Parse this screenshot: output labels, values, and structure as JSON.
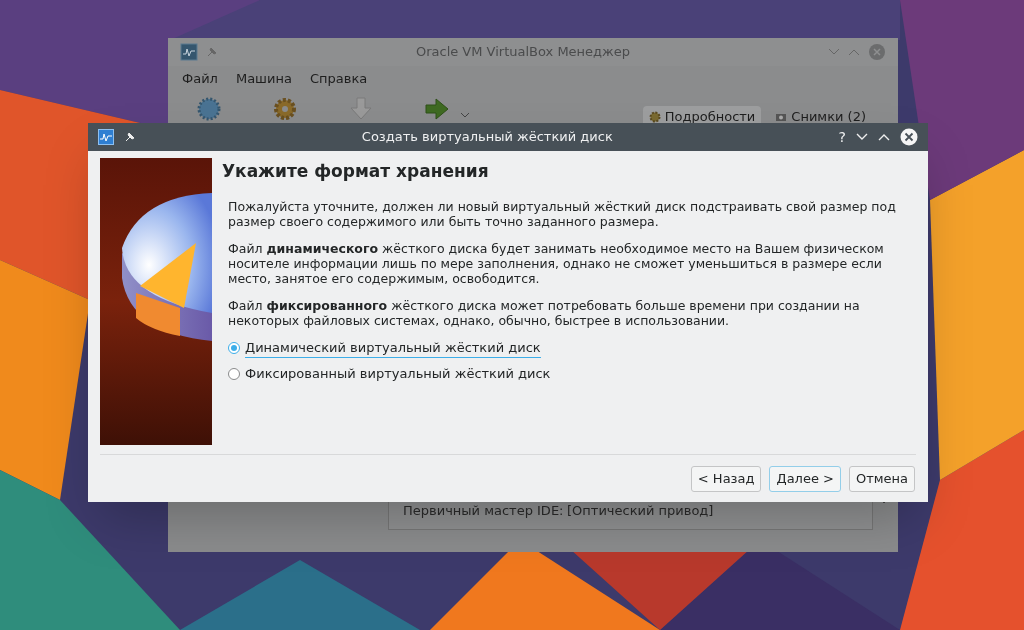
{
  "manager_window": {
    "title": "Oracle VM VirtualBox Менеджер",
    "menu": [
      "Файл",
      "Машина",
      "Справка"
    ],
    "tabs": [
      {
        "label": "Подробности",
        "selected": true
      },
      {
        "label": "Снимки (2)",
        "selected": false
      }
    ],
    "details": [
      {
        "label": "Первичный мастер IDE:",
        "value": "[Оптический привод]"
      }
    ]
  },
  "dialog": {
    "title": "Создать виртуальный жёсткий диск",
    "title_buttons": [
      "?"
    ],
    "heading": "Укажите формат хранения",
    "paragraphs": [
      "Пожалуйста уточните, должен ли новый виртуальный жёсткий диск подстраивать свой размер под размер своего содержимого или быть точно заданного размера.",
      "Файл **динамического** жёсткого диска будет занимать необходимое место на Вашем физическом носителе информации лишь по мере заполнения, однако не сможет уменьшиться в размере если место, занятое его содержимым, освободится.",
      "Файл **фиксированного** жёсткого диска может потребовать больше времени при создании на некоторых файловых системах, однако, обычно, быстрее в использовании."
    ],
    "options": [
      {
        "label": "Динамический виртуальный жёсткий диск",
        "selected": true
      },
      {
        "label": "Фиксированный виртуальный жёсткий диск",
        "selected": false
      }
    ],
    "buttons": [
      {
        "label": "< Назад",
        "kind": "normal"
      },
      {
        "label": "Далее >",
        "kind": "default"
      },
      {
        "label": "Отмена",
        "kind": "normal"
      }
    ]
  }
}
